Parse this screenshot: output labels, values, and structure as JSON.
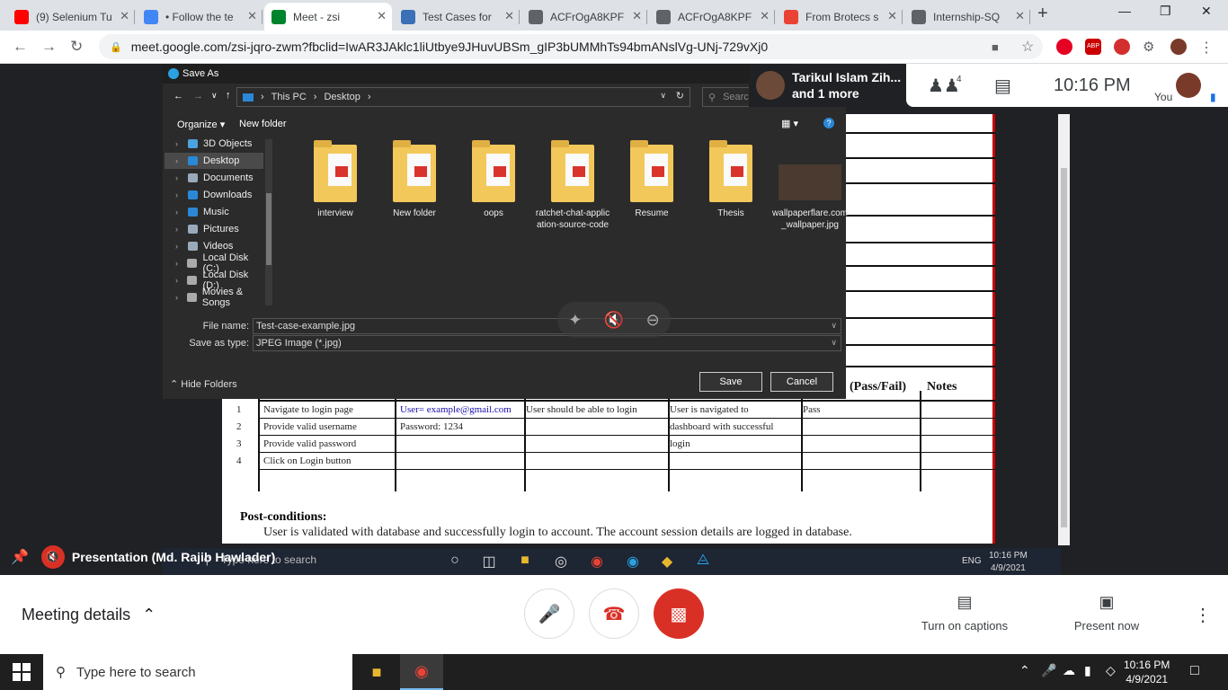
{
  "browser": {
    "tabs": [
      {
        "title": "(9) Selenium Tu",
        "icon": "youtube-icon",
        "color": "#ff0000"
      },
      {
        "title": "• Follow the te",
        "icon": "google-icon",
        "color": "#4285f4"
      },
      {
        "title": "Meet - zsi",
        "icon": "meet-icon",
        "color": "#00832d",
        "active": true
      },
      {
        "title": "Test Cases for",
        "icon": "ste-icon",
        "color": "#3b6fb6"
      },
      {
        "title": "ACFrOgA8KPF",
        "icon": "globe-icon",
        "color": "#5f6368"
      },
      {
        "title": "ACFrOgA8KPF",
        "icon": "globe-icon",
        "color": "#5f6368"
      },
      {
        "title": "From Brotecs s",
        "icon": "gmail-icon",
        "color": "#ea4335"
      },
      {
        "title": "Internship-SQ",
        "icon": "globe-icon",
        "color": "#5f6368"
      }
    ],
    "url": "meet.google.com/zsi-jqro-zwm?fbclid=IwAR3JAklc1liUtbye9JHuvUBSm_gIP3bUMMhTs94bmANslVg-UNj-729vXj0"
  },
  "dialog": {
    "title": "Save As",
    "path": [
      "This PC",
      "Desktop"
    ],
    "search_placeholder": "Search Desktop",
    "organize": "Organize",
    "new_folder": "New folder",
    "sidebar": [
      {
        "label": "3D Objects",
        "icon": "3d-objects-icon",
        "color": "#4aa3df"
      },
      {
        "label": "Desktop",
        "icon": "desktop-icon",
        "color": "#2b88d8",
        "selected": true
      },
      {
        "label": "Documents",
        "icon": "documents-icon",
        "color": "#9ab"
      },
      {
        "label": "Downloads",
        "icon": "downloads-icon",
        "color": "#2b88d8"
      },
      {
        "label": "Music",
        "icon": "music-icon",
        "color": "#2b88d8"
      },
      {
        "label": "Pictures",
        "icon": "pictures-icon",
        "color": "#9ab"
      },
      {
        "label": "Videos",
        "icon": "videos-icon",
        "color": "#9ab"
      },
      {
        "label": "Local Disk (C:)",
        "icon": "disk-icon",
        "color": "#aaa"
      },
      {
        "label": "Local Disk (D:)",
        "icon": "disk-icon",
        "color": "#aaa"
      },
      {
        "label": "Movies & Songs",
        "icon": "disk-icon",
        "color": "#aaa"
      }
    ],
    "files": [
      {
        "name": "interview",
        "kind": "folder"
      },
      {
        "name": "New folder",
        "kind": "folder"
      },
      {
        "name": "oops",
        "kind": "folder"
      },
      {
        "name": "ratchet-chat-application-source-code",
        "kind": "folder"
      },
      {
        "name": "Resume",
        "kind": "folder"
      },
      {
        "name": "Thesis",
        "kind": "folder"
      },
      {
        "name": "wallpaperflare.com_wallpaper.jpg",
        "kind": "image"
      }
    ],
    "file_name_label": "File name:",
    "file_name": "Test-case-example.jpg",
    "save_type_label": "Save as type:",
    "save_type": "JPEG Image (*.jpg)",
    "hide_folders": "Hide Folders",
    "save": "Save",
    "cancel": "Cancel"
  },
  "document": {
    "header_pass": "(Pass/Fail)",
    "header_notes": "Notes",
    "rows": [
      {
        "n": "1",
        "step": "Navigate to login page",
        "data": "User= example@gmail.com",
        "expected": "User should be able to login",
        "actual": "User is navigated to",
        "status": "Pass"
      },
      {
        "n": "2",
        "step": "Provide valid username",
        "data": "Password: 1234",
        "expected": "",
        "actual": "dashboard with successful",
        "status": ""
      },
      {
        "n": "3",
        "step": "Provide valid password",
        "data": "",
        "expected": "",
        "actual": "login",
        "status": ""
      },
      {
        "n": "4",
        "step": "Click on Login button",
        "data": "",
        "expected": "",
        "actual": "",
        "status": ""
      }
    ],
    "post_title": "Post-conditions:",
    "post_text": "User is validated with database and successfully login to account. The account session details are logged in database."
  },
  "meet": {
    "pinned_name": "Tarikul Islam Zih...",
    "pinned_more": "and 1 more",
    "participants_count": "4",
    "time": "10:16 PM",
    "you": "You",
    "presenter": "Presentation (Md. Rajib Hawlader)",
    "inner_taskbar_search": "Type here to search",
    "inner_lang": "ENG",
    "inner_time": "10:16 PM",
    "inner_date": "4/9/2021",
    "meeting_details": "Meeting details",
    "captions": "Turn on captions",
    "present": "Present now"
  },
  "taskbar": {
    "search": "Type here to search",
    "time": "10:16 PM",
    "date": "4/9/2021"
  }
}
